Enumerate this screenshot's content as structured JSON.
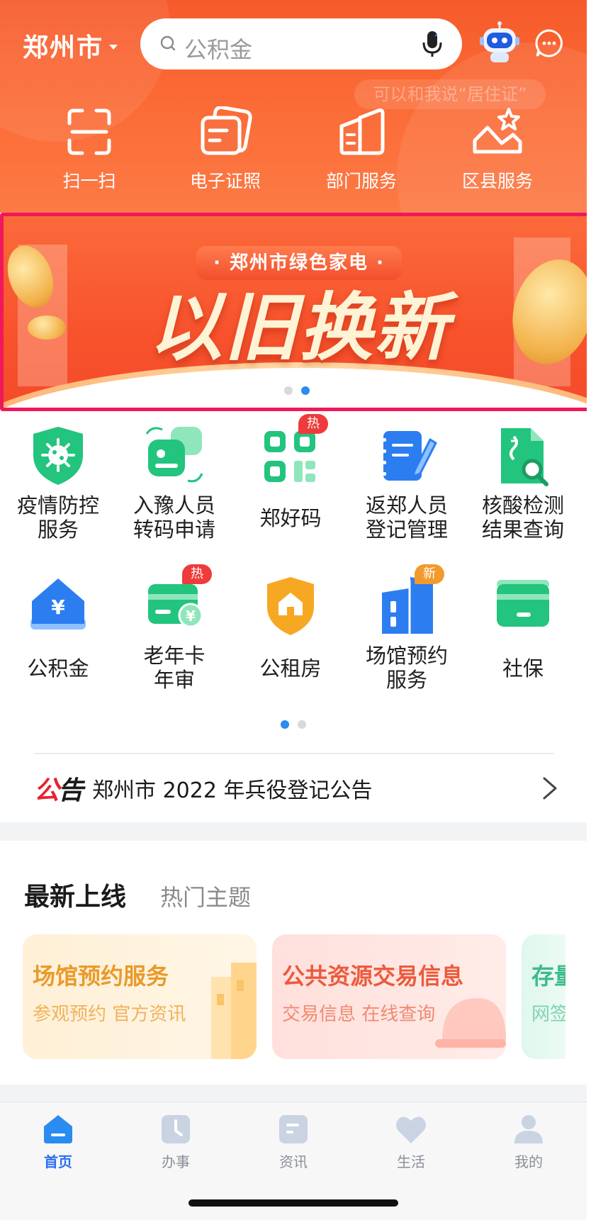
{
  "header": {
    "city": "郑州市",
    "search_placeholder": "公积金",
    "assistant_hint": "可以和我说“居住证”"
  },
  "quick_actions": [
    {
      "label": "扫一扫",
      "icon": "scan-icon"
    },
    {
      "label": "电子证照",
      "icon": "id-cards-icon"
    },
    {
      "label": "部门服务",
      "icon": "department-icon"
    },
    {
      "label": "区县服务",
      "icon": "district-star-icon"
    }
  ],
  "banner": {
    "subtitle": "· 郑州市绿色家电 ·",
    "headline": "以旧换新",
    "page_count": 2,
    "active_page": 2
  },
  "services": [
    {
      "label": "疫情防控\n服务",
      "icon": "epidemic-shield-icon",
      "badge": ""
    },
    {
      "label": "入豫人员\n转码申请",
      "icon": "code-transfer-icon",
      "badge": ""
    },
    {
      "label": "郑好码",
      "icon": "qr-code-icon",
      "badge": "热"
    },
    {
      "label": "返郑人员\n登记管理",
      "icon": "registration-notebook-icon",
      "badge": ""
    },
    {
      "label": "核酸检测\n结果查询",
      "icon": "test-result-search-icon",
      "badge": ""
    },
    {
      "label": "公积金",
      "icon": "housing-fund-icon",
      "badge": ""
    },
    {
      "label": "老年卡\n年审",
      "icon": "senior-card-icon",
      "badge": "热"
    },
    {
      "label": "公租房",
      "icon": "public-rental-icon",
      "badge": ""
    },
    {
      "label": "场馆预约\n服务",
      "icon": "venue-booking-icon",
      "badge": "新"
    },
    {
      "label": "社保",
      "icon": "social-security-card-icon",
      "badge": ""
    }
  ],
  "services_pager": {
    "page_count": 2,
    "active_page": 1
  },
  "notice": {
    "tag_black": "公",
    "tag_red": "告",
    "text": "郑州市 2022 年兵役登记公告"
  },
  "latest": {
    "tab_active": "最新上线",
    "tab_other": "热门主题",
    "cards": [
      {
        "title": "场馆预约服务",
        "subtitle": "参观预约 官方资讯",
        "accent": "#f2a43a"
      },
      {
        "title": "公共资源交易信息",
        "subtitle": "交易信息 在线查询",
        "accent": "#ef6a4a"
      },
      {
        "title": "存量",
        "subtitle": "网签",
        "accent": "#3dbb8a"
      }
    ]
  },
  "tabbar": [
    {
      "label": "首页",
      "icon": "home-icon",
      "active": true
    },
    {
      "label": "办事",
      "icon": "clock-icon",
      "active": false
    },
    {
      "label": "资讯",
      "icon": "news-icon",
      "active": false
    },
    {
      "label": "生活",
      "icon": "heart-icon",
      "active": false
    },
    {
      "label": "我的",
      "icon": "user-icon",
      "active": false
    }
  ],
  "colors": {
    "brand_orange": "#f65a2b",
    "highlight_border": "#f0185a",
    "active_blue": "#2a6ef5",
    "service_green": "#22c47e",
    "service_blue": "#2c7ef0",
    "hot_red": "#ef3b3b"
  }
}
